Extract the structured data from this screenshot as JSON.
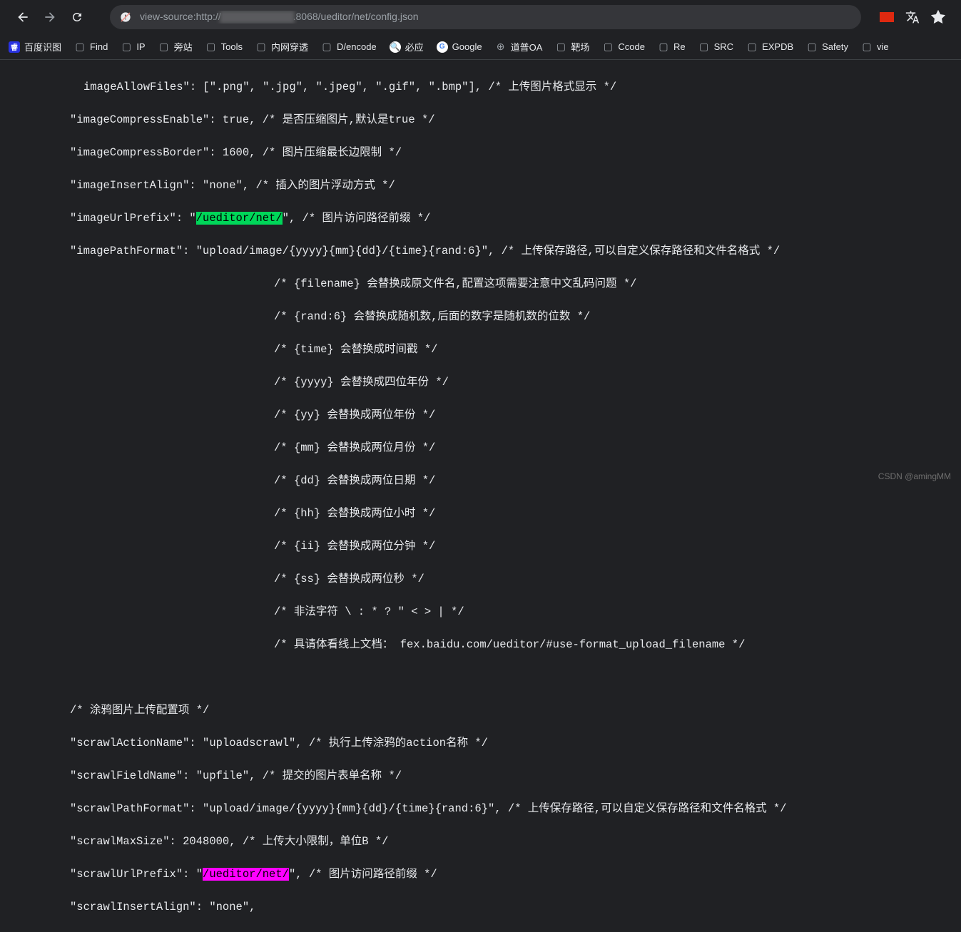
{
  "url": {
    "prefix": "view-source:",
    "protocol": "http://",
    "suffix": ".8068/ueditor/net/config.json"
  },
  "bookmarks": [
    {
      "label": "百度识图",
      "icon": "baidu"
    },
    {
      "label": "Find",
      "icon": "folder"
    },
    {
      "label": "IP",
      "icon": "folder"
    },
    {
      "label": "旁站",
      "icon": "folder"
    },
    {
      "label": "Tools",
      "icon": "folder"
    },
    {
      "label": "内网穿透",
      "icon": "folder"
    },
    {
      "label": "D/encode",
      "icon": "folder"
    },
    {
      "label": "必应",
      "icon": "bing"
    },
    {
      "label": "Google",
      "icon": "google"
    },
    {
      "label": "道普OA",
      "icon": "globe"
    },
    {
      "label": "靶场",
      "icon": "folder"
    },
    {
      "label": "Ccode",
      "icon": "folder"
    },
    {
      "label": "Re",
      "icon": "folder"
    },
    {
      "label": "SRC",
      "icon": "folder"
    },
    {
      "label": "EXPDB",
      "icon": "folder"
    },
    {
      "label": "Safety",
      "icon": "folder"
    },
    {
      "label": "vie",
      "icon": "folder"
    }
  ],
  "source": {
    "line1": "imageAllowFiles\": [\".png\", \".jpg\", \".jpeg\", \".gif\", \".bmp\"], /* 上传图片格式显示 */",
    "line2": "\"imageCompressEnable\": true, /* 是否压缩图片,默认是true */",
    "line3": "\"imageCompressBorder\": 1600, /* 图片压缩最长边限制 */",
    "line4": "\"imageInsertAlign\": \"none\", /* 插入的图片浮动方式 */",
    "line5a": "\"imageUrlPrefix\": \"",
    "line5hl": "/ueditor/net/",
    "line5b": "\", /* 图片访问路径前缀 */",
    "line6": "\"imagePathFormat\": \"upload/image/{yyyy}{mm}{dd}/{time}{rand:6}\", /* 上传保存路径,可以自定义保存路径和文件名格式 */",
    "c1": "/* {filename} 会替换成原文件名,配置这项需要注意中文乱码问题 */",
    "c2": "/* {rand:6} 会替换成随机数,后面的数字是随机数的位数 */",
    "c3": "/* {time} 会替换成时间戳 */",
    "c4": "/* {yyyy} 会替换成四位年份 */",
    "c5": "/* {yy} 会替换成两位年份 */",
    "c6": "/* {mm} 会替换成两位月份 */",
    "c7": "/* {dd} 会替换成两位日期 */",
    "c8": "/* {hh} 会替换成两位小时 */",
    "c9": "/* {ii} 会替换成两位分钟 */",
    "c10": "/* {ss} 会替换成两位秒 */",
    "c11": "/* 非法字符 \\ : * ? \" < > | */",
    "c12": "/* 具请体看线上文档： fex.baidu.com/ueditor/#use-format_upload_filename */",
    "s1": "/* 涂鸦图片上传配置项 */",
    "s2": "\"scrawlActionName\": \"uploadscrawl\", /* 执行上传涂鸦的action名称 */",
    "s3": "\"scrawlFieldName\": \"upfile\", /* 提交的图片表单名称 */",
    "s4": "\"scrawlPathFormat\": \"upload/image/{yyyy}{mm}{dd}/{time}{rand:6}\", /* 上传保存路径,可以自定义保存路径和文件名格式 */",
    "s5": "\"scrawlMaxSize\": 2048000, /* 上传大小限制，单位B */",
    "s6a": "\"scrawlUrlPrefix\": \"",
    "s6hl": "/ueditor/net/",
    "s6b": "\", /* 图片访问路径前缀 */",
    "s7": "\"scrawlInsertAlign\": \"none\","
  },
  "watermark": "CSDN @amingMM"
}
